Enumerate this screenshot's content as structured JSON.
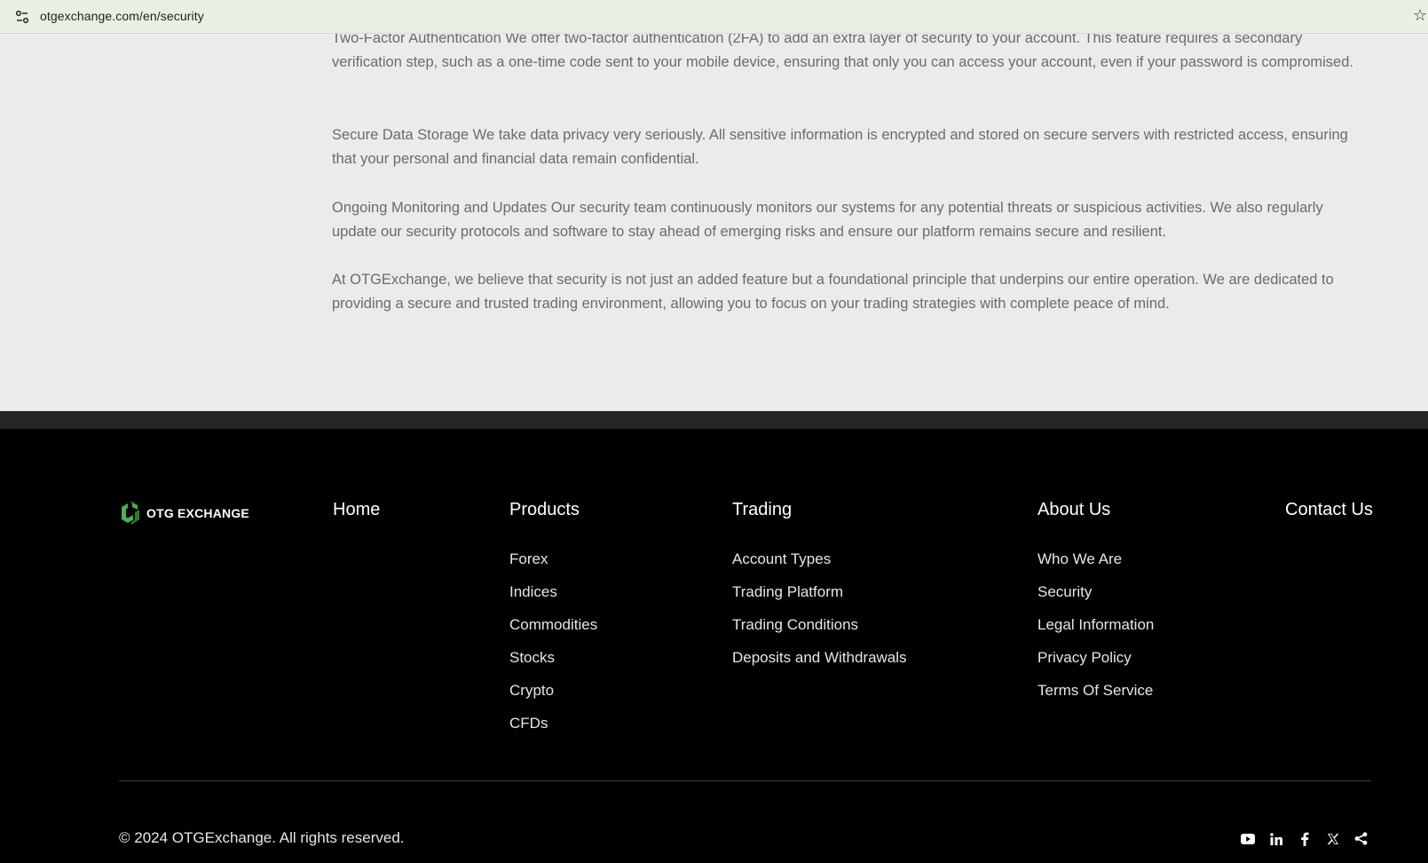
{
  "browser": {
    "url": "otgexchange.com/en/security"
  },
  "content": {
    "paragraphs": [
      "Two-Factor Authentication We offer two-factor authentication (2FA) to add an extra layer of security to your account. This feature requires a secondary verification step, such as a one-time code sent to your mobile device, ensuring that only you can access your account, even if your password is compromised.",
      "Secure Data Storage We take data privacy very seriously. All sensitive information is encrypted and stored on secure servers with restricted access, ensuring that your personal and financial data remain confidential.",
      "Ongoing Monitoring and Updates Our security team continuously monitors our systems for any potential threats or suspicious activities. We also regularly update our security protocols and software to stay ahead of emerging risks and ensure our platform remains secure and resilient.",
      "At OTGExchange, we believe that security is not just an added feature but a foundational principle that underpins our entire operation. We are dedicated to providing a secure and trusted trading environment, allowing you to focus on your trading strategies with complete peace of mind."
    ]
  },
  "footer": {
    "logo_text": "OTG EXCHANGE",
    "brand_color": "#4caf50",
    "home": "Home",
    "products": {
      "heading": "Products",
      "items": [
        "Forex",
        "Indices",
        "Commodities",
        "Stocks",
        "Crypto",
        "CFDs"
      ]
    },
    "trading": {
      "heading": "Trading",
      "items": [
        "Account Types",
        "Trading Platform",
        "Trading Conditions",
        "Deposits and Withdrawals"
      ]
    },
    "about": {
      "heading": "About Us",
      "items": [
        "Who We Are",
        "Security",
        "Legal Information",
        "Privacy Policy",
        "Terms Of Service"
      ]
    },
    "contact": "Contact Us",
    "copyright": "© 2024 OTGExchange. All rights reserved.",
    "social": [
      "youtube-icon",
      "linkedin-icon",
      "facebook-icon",
      "x-icon",
      "share-icon"
    ]
  }
}
